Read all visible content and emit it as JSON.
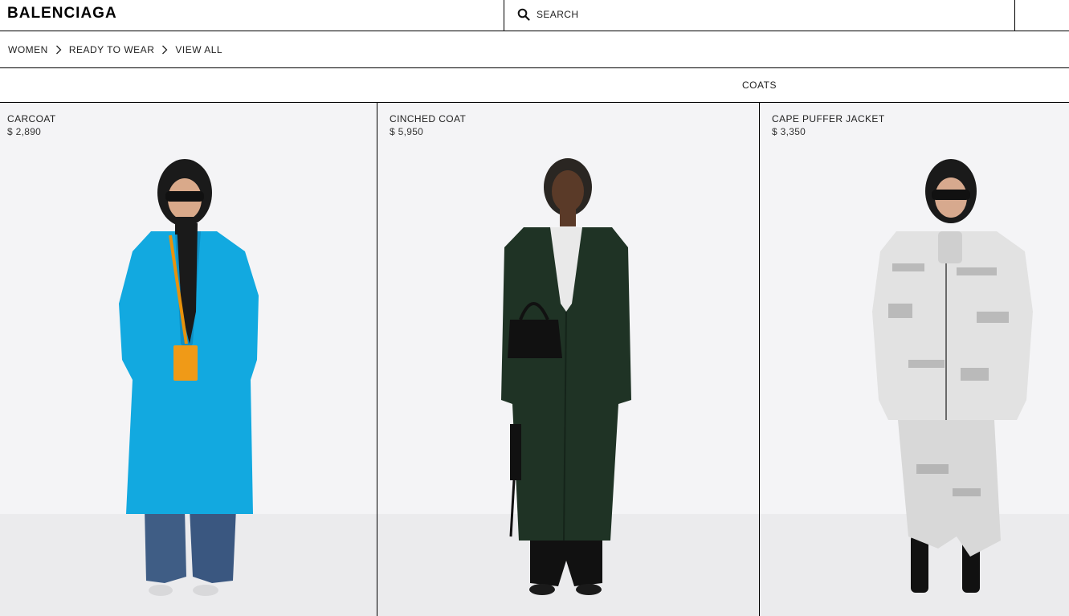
{
  "header": {
    "logo": "BALENCIAGA",
    "search_label": "SEARCH"
  },
  "breadcrumb": [
    "WOMEN",
    "READY TO WEAR",
    "VIEW ALL"
  ],
  "subnav": {
    "active": "COATS"
  },
  "products": [
    {
      "name": "CARCOAT",
      "price": "$ 2,890",
      "coat_color": "#12a9e0"
    },
    {
      "name": "CINCHED COAT",
      "price": "$ 5,950",
      "coat_color": "#1f3325"
    },
    {
      "name": "CAPE PUFFER JACKET",
      "price": "$ 3,350",
      "coat_color": "#e2e2e2"
    }
  ],
  "icons": {
    "search": "search-icon",
    "chevron": "chevron-right-icon"
  }
}
